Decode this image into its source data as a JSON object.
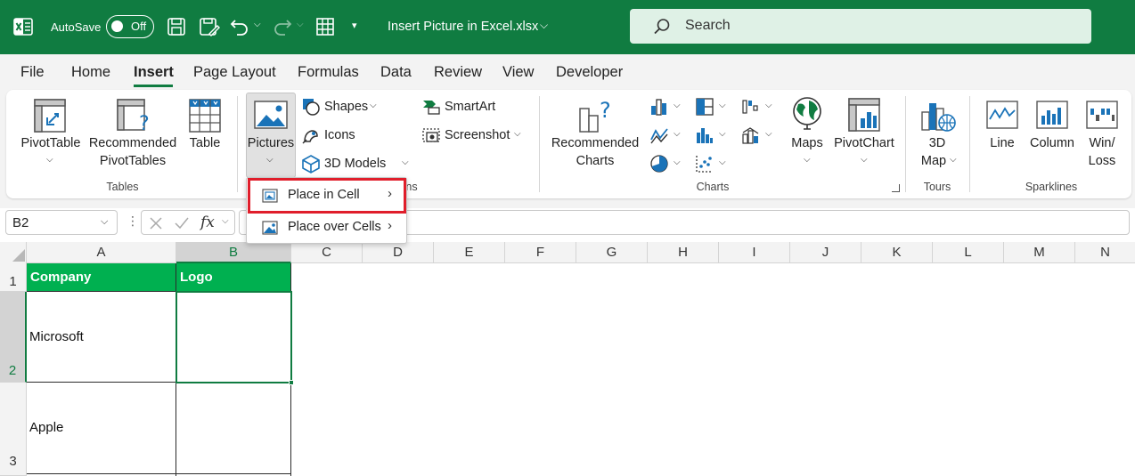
{
  "titlebar": {
    "autosave_label": "AutoSave",
    "autosave_state": "Off",
    "filename": "Insert Picture in Excel.xlsx",
    "search_placeholder": "Search"
  },
  "tabs": [
    "File",
    "Home",
    "Insert",
    "Page Layout",
    "Formulas",
    "Data",
    "Review",
    "View",
    "Developer"
  ],
  "ribbon": {
    "tables": {
      "pivottable": "PivotTable",
      "recommended_pivot_1": "Recommended",
      "recommended_pivot_2": "PivotTables",
      "table": "Table",
      "group": "Tables"
    },
    "illustrations": {
      "pictures": "Pictures",
      "shapes": "Shapes",
      "icons": "Icons",
      "models": "3D Models",
      "smartart": "SmartArt",
      "screenshot": "Screenshot",
      "group_partial": "ns"
    },
    "charts": {
      "recommended_1": "Recommended",
      "recommended_2": "Charts",
      "maps": "Maps",
      "pivotchart": "PivotChart",
      "group": "Charts"
    },
    "tours": {
      "map_1": "3D",
      "map_2": "Map",
      "group": "Tours"
    },
    "sparklines": {
      "line": "Line",
      "column": "Column",
      "winloss_1": "Win/",
      "winloss_2": "Loss",
      "group": "Sparklines"
    }
  },
  "dropdown": {
    "place_in_cell": "Place in Cell",
    "place_over_cells": "Place over Cells"
  },
  "formula_bar": {
    "name_box": "B2",
    "fx": "fx"
  },
  "grid": {
    "columns": [
      "A",
      "B",
      "C",
      "D",
      "E",
      "F",
      "G",
      "H",
      "I",
      "J",
      "K",
      "L",
      "M",
      "N"
    ],
    "rows": [
      "1",
      "2",
      "3"
    ],
    "header_a": "Company",
    "header_b": "Logo",
    "a2": "Microsoft",
    "a3": "Apple"
  },
  "colors": {
    "excel_green": "#107c41",
    "header_fill": "#00b050",
    "highlight_red": "#e01e2b"
  }
}
